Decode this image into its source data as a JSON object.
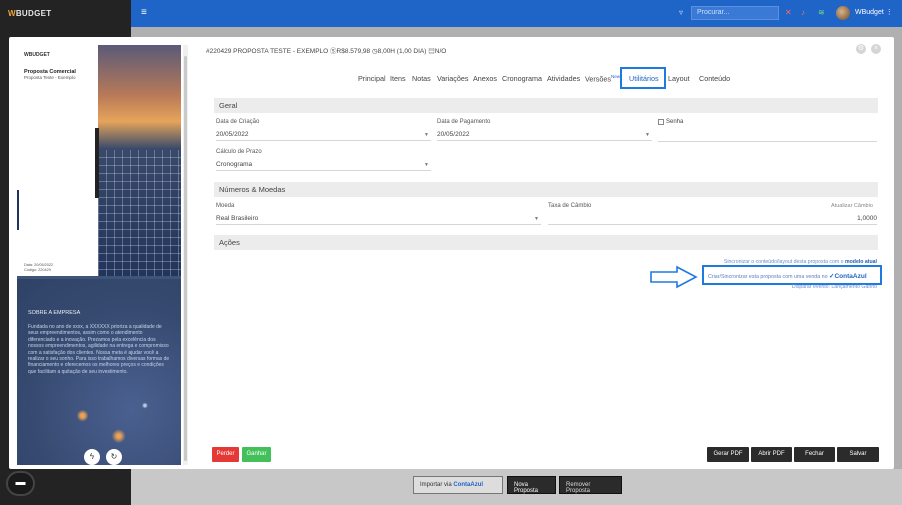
{
  "app": {
    "logo_prefix": "W",
    "logo_rest": "BUDGET",
    "username": "WBudget"
  },
  "topbar": {
    "search_placeholder": "Procurar..."
  },
  "modal": {
    "title": "#220429 PROPOSTA TESTE - EXEMPLO",
    "value": "R$8.579,98",
    "duration": "8,00H (1,00 DIA)",
    "status": "N/O"
  },
  "preview": {
    "page1": {
      "logo": "WBUDGET",
      "title": "Proposta Comercial",
      "subtitle": "Proposta Teste - Exemplo",
      "date_line": "Data: 20/05/2022",
      "code_line": "Código: 220429"
    },
    "page2": {
      "title": "SOBRE A EMPRESA",
      "text": "Fundada no ano de xxxx, a XXXXXX prioriza a qualidade de seus empreendimentos, assim como o atendimento diferenciado e a inovação. Prezamos pela excelência dos nossos empreendimentos, agilidade na entrega e compromisso com a satisfação dos clientes. Nossa meta é ajudar você a realizar o seu sonho. Para isso trabalhamos diversas formas de financiamento e oferecemos os melhores preços e condições que facilitam a quitação de seu investimento."
    }
  },
  "tabs": [
    {
      "label": "Principal"
    },
    {
      "label": "Itens"
    },
    {
      "label": "Notas"
    },
    {
      "label": "Variações"
    },
    {
      "label": "Anexos"
    },
    {
      "label": "Cronograma"
    },
    {
      "label": "Atividades"
    },
    {
      "label": "Versões",
      "badge": "New"
    },
    {
      "label": "Utilitários",
      "active": true
    },
    {
      "label": "Layout"
    },
    {
      "label": "Conteúdo"
    }
  ],
  "geral": {
    "section_title": "Geral",
    "data_criacao_label": "Data de Criação",
    "data_criacao_value": "20/05/2022",
    "data_pagamento_label": "Data de Pagamento",
    "data_pagamento_value": "20/05/2022",
    "senha_label": "Senha",
    "calculo_prazo_label": "Cálculo de Prazo",
    "calculo_prazo_value": "Cronograma"
  },
  "numeros": {
    "section_title": "Números & Moedas",
    "moeda_label": "Moeda",
    "moeda_value": "Real Brasileiro",
    "taxa_label": "Taxa de Câmbio",
    "taxa_value": "1,0000",
    "atualizar_label": "Atualizar Câmbio"
  },
  "acoes": {
    "section_title": "Ações",
    "link1_text": "Sincronizar o conteúdo/layout desta proposta com o ",
    "link1_bold": "modelo atual",
    "conta_azul_text": "Criar/Sincronizar esta proposta com uma venda no",
    "conta_azul_brand": "ContaAzul",
    "link3": "Disparar evento: Lançamento Ganho"
  },
  "footer_buttons": {
    "perder": "Perder",
    "ganhar": "Ganhar",
    "gerar_pdf": "Gerar PDF",
    "abrir_pdf": "Abrir PDF",
    "fechar": "Fechar",
    "salvar": "Salvar"
  },
  "bottom_bar": {
    "importar": "Importar via",
    "importar_brand": "ContaAzul",
    "nova_proposta": "Nova Proposta",
    "remover_proposta": "Remover Proposta"
  },
  "colors": {
    "primary": "#1f64c7",
    "sidebar": "#232323",
    "danger": "#e53935",
    "success": "#43c05a",
    "highlight": "#1f7ae0"
  }
}
